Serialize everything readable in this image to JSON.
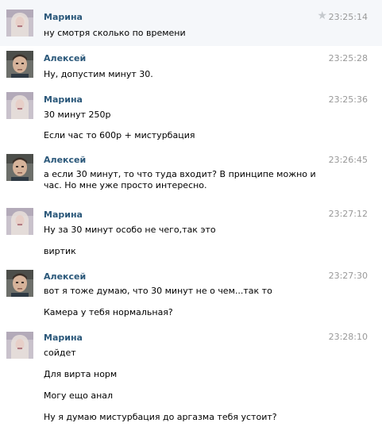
{
  "messages": [
    {
      "author": "Марина",
      "time": "23:25:14",
      "avatar": "marina-avatar",
      "starred": true,
      "lines": [
        "ну смотря сколько по времени"
      ]
    },
    {
      "author": "Алексей",
      "time": "23:25:28",
      "avatar": "aleksey-avatar",
      "lines": [
        "Ну, допустим минут 30."
      ]
    },
    {
      "author": "Марина",
      "time": "23:25:36",
      "avatar": "marina-avatar",
      "lines": [
        "30 минут 250р",
        "Если час то 600р + мистурбация"
      ]
    },
    {
      "author": "Алексей",
      "time": "23:26:45",
      "avatar": "aleksey-avatar",
      "lines": [
        "а если 30 минут, то что туда входит? В принципе можно и час. Но мне уже просто интересно."
      ]
    },
    {
      "author": "Марина",
      "time": "23:27:12",
      "avatar": "marina-avatar",
      "lines": [
        "Ну за 30 минут особо не чего,так это",
        "виртик"
      ]
    },
    {
      "author": "Алексей",
      "time": "23:27:30",
      "avatar": "aleksey-avatar",
      "lines": [
        "вот я тоже думаю, что 30 минут не о чем...так то",
        "Камера у тебя нормальная?"
      ]
    },
    {
      "author": "Марина",
      "time": "23:28:10",
      "avatar": "marina-avatar",
      "lines": [
        "сойдет",
        "Для вирта норм",
        "Могу ещо анал",
        "Ну я думаю мистурбация до аргазма тебя устоит?"
      ]
    }
  ]
}
